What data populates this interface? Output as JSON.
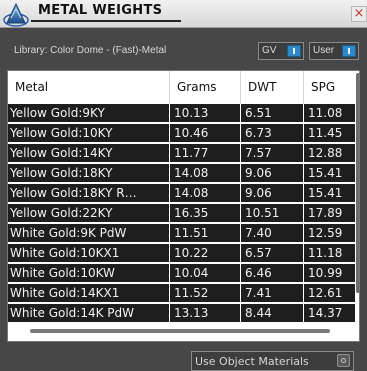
{
  "window": {
    "title": "METAL WEIGHTS",
    "close_label": "×"
  },
  "toolbar": {
    "library_label": "Library: Color Dome - (Fast)-Metal",
    "view_select": "GV",
    "mode_select": "User"
  },
  "table": {
    "columns": [
      "Metal",
      "Grams",
      "DWT",
      "SPG"
    ],
    "rows": [
      [
        "Yellow Gold:9KY",
        "10.13",
        "6.51",
        "11.08"
      ],
      [
        "Yellow Gold:10KY",
        "10.46",
        "6.73",
        "11.45"
      ],
      [
        "Yellow Gold:14KY",
        "11.77",
        "7.57",
        "12.88"
      ],
      [
        "Yellow Gold:18KY",
        "14.08",
        "9.06",
        "15.41"
      ],
      [
        "Yellow Gold:18KY R…",
        "14.08",
        "9.06",
        "15.41"
      ],
      [
        "Yellow Gold:22KY",
        "16.35",
        "10.51",
        "17.89"
      ],
      [
        "White Gold:9K PdW",
        "11.51",
        "7.40",
        "12.59"
      ],
      [
        "White Gold:10KX1",
        "10.22",
        "6.57",
        "11.18"
      ],
      [
        "White Gold:10KW",
        "10.04",
        "6.46",
        "10.99"
      ],
      [
        "White Gold:14KX1",
        "11.52",
        "7.41",
        "12.61"
      ],
      [
        "White Gold:14K PdW",
        "13.13",
        "8.44",
        "14.37"
      ]
    ]
  },
  "footer": {
    "use_object_materials_label": "Use Object Materials"
  }
}
